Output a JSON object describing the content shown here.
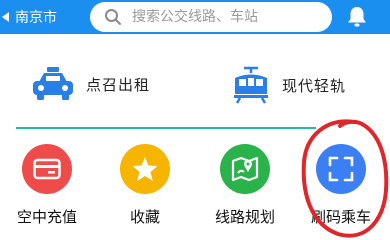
{
  "header": {
    "city": "南京市",
    "search_placeholder": "搜索公交线路、车站",
    "icons": {
      "city_caret": "caret-left-icon",
      "search": "search-icon",
      "notification": "bell-icon"
    }
  },
  "features": [
    {
      "label": "点召出租",
      "icon": "taxi-icon",
      "color": "#2a7ee8"
    },
    {
      "label": "现代轻轨",
      "icon": "tram-icon",
      "color": "#2a7ee8"
    }
  ],
  "divider_color": "#2db6a3",
  "tiles": [
    {
      "label": "空中充值",
      "icon": "card-icon",
      "color": "#ef4b4b"
    },
    {
      "label": "收藏",
      "icon": "star-icon",
      "color": "#f6b500"
    },
    {
      "label": "线路规划",
      "icon": "map-route-icon",
      "color": "#2ab34a"
    },
    {
      "label": "刷码乘车",
      "icon": "scan-icon",
      "color": "#3b7ff2"
    }
  ],
  "colors": {
    "header": "#1a8ff0",
    "annotation": "#e0262b"
  }
}
